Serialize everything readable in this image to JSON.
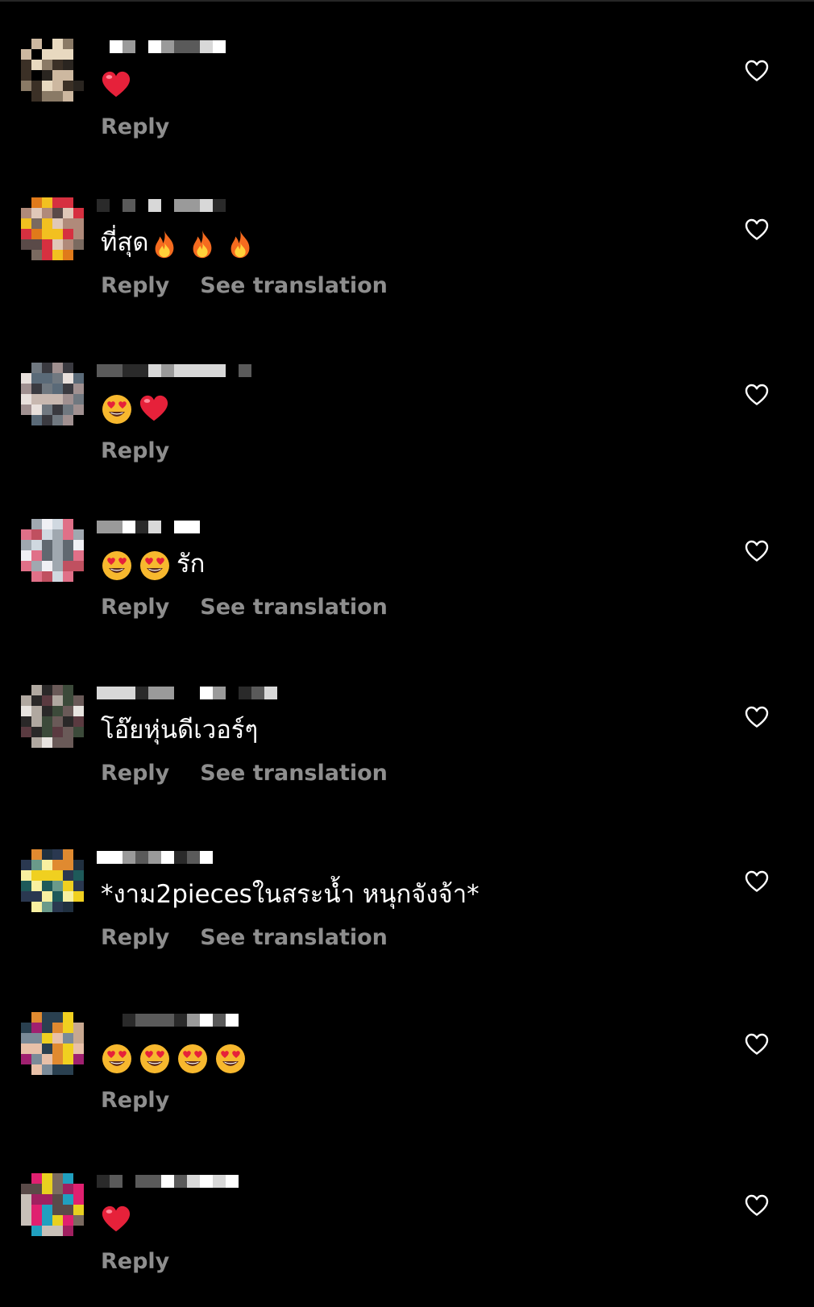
{
  "colors": {
    "background": "#000000",
    "text": "#ffffff",
    "secondary": "#8e8e8e",
    "heart_emoji": "#e6213a",
    "face_emoji": "#f7b82e",
    "fire_emoji": "#f56b1f"
  },
  "icons": {
    "like": "heart-outline-icon",
    "avatar": "pixelated-avatar",
    "username": "pixelated-username"
  },
  "comments": [
    {
      "text": "",
      "emojis_before": [
        "heart"
      ],
      "emojis_after": [],
      "reply_label": "Reply",
      "translation_label": ""
    },
    {
      "text": "ที่สุด",
      "emojis_before": [],
      "emojis_after": [
        "fire",
        "fire",
        "fire"
      ],
      "reply_label": "Reply",
      "translation_label": "See translation"
    },
    {
      "text": "",
      "emojis_before": [
        "heart-eyes",
        "heart"
      ],
      "emojis_after": [],
      "reply_label": "Reply",
      "translation_label": ""
    },
    {
      "text": "รัก",
      "emojis_before": [
        "heart-eyes",
        "heart-eyes"
      ],
      "emojis_after": [],
      "reply_label": "Reply",
      "translation_label": "See translation"
    },
    {
      "text": "โอ๊ยหุ่นดีเวอร์ๆ",
      "emojis_before": [],
      "emojis_after": [],
      "reply_label": "Reply",
      "translation_label": "See translation"
    },
    {
      "text": "*งาม2piecesในสระน้ำ หนุกจังจ้า*",
      "emojis_before": [],
      "emojis_after": [],
      "reply_label": "Reply",
      "translation_label": "See translation"
    },
    {
      "text": "",
      "emojis_before": [
        "heart-eyes",
        "heart-eyes",
        "heart-eyes",
        "heart-eyes"
      ],
      "emojis_after": [],
      "reply_label": "Reply",
      "translation_label": ""
    },
    {
      "text": "",
      "emojis_before": [
        "heart"
      ],
      "emojis_after": [],
      "reply_label": "Reply",
      "translation_label": ""
    }
  ]
}
